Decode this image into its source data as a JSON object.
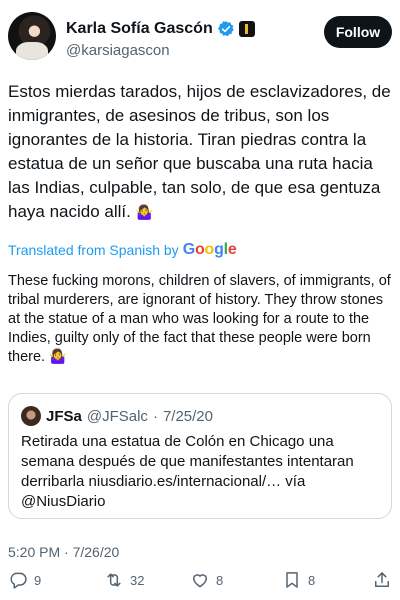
{
  "author": {
    "name": "Karla Sofía Gascón",
    "handle": "@karsiagascon",
    "follow_label": "Follow"
  },
  "tweet": {
    "text": "Estos mierdas tarados, hijos de esclavizadores, de inmigrantes, de asesinos de tribus, son los ignorantes de la historia. Tiran piedras contra la estatua de un señor que buscaba una ruta hacia las Indias, culpable, tan solo, de que esa gentuza haya nacido allí.",
    "emoji": "🤷‍♀️",
    "translated_label": "Translated from Spanish by",
    "google_letters": [
      "G",
      "o",
      "o",
      "g",
      "l",
      "e"
    ],
    "translation": "These fucking morons, children of slavers, of immigrants, of tribal murderers, are ignorant of history. They throw stones at the statue of a man who was looking for a route to the Indies, guilty only of the fact that these people were born there.",
    "timestamp": "5:20 PM · 7/26/20"
  },
  "quoted": {
    "name": "JFSa",
    "handle": "@JFSalc",
    "date": "7/25/20",
    "separator": "·",
    "text": "Retirada una estatua de Colón en Chicago una semana después de que manifestantes intentaran derribarla niusdiario.es/internacional/… vía @NiusDiario"
  },
  "actions": {
    "replies": "9",
    "retweets": "32",
    "likes": "8",
    "bookmarks": "8"
  },
  "colors": {
    "accent": "#1d9bf0",
    "text": "#0f1419",
    "muted": "#536471",
    "border": "#cfd9de"
  }
}
